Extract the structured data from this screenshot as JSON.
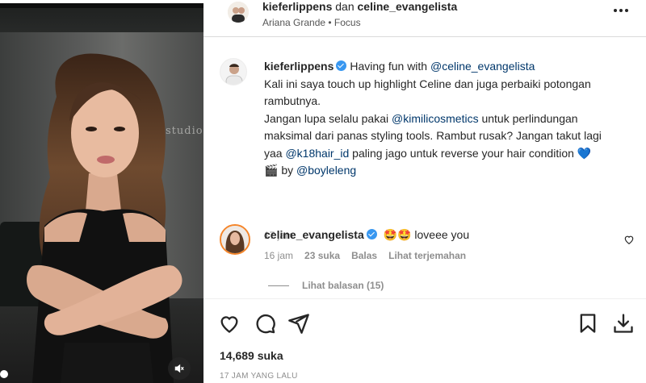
{
  "media": {
    "studio_sign": "studio",
    "progress": 1.0
  },
  "header": {
    "user1": "kieferlippens",
    "joiner": "dan",
    "user2": "celine_evangelista",
    "audio": "Ariana Grande • Focus"
  },
  "caption": {
    "username": "kieferlippens",
    "line1_intro": "Having fun with ",
    "mention1": "@celine_evangelista",
    "line2": "Kali ini saya touch up highlight Celine dan juga perbaiki potongan rambutnya.",
    "line3_a": "Jangan lupa selalu pakai ",
    "mention2": "@kimilicosmetics",
    "line3_b": " untuk perlindungan maksimal dari panas styling tools. Rambut rusak? Jangan takut lagi yaa ",
    "mention3": "@k18hair_id",
    "line3_c": " paling jago untuk reverse your hair condition",
    "heart": "💙",
    "credit_icon": "🎬",
    "credit_by": "by ",
    "mention4": "@boyleleng",
    "time": "17 jam"
  },
  "comment": {
    "username": "celine_evangelista",
    "emojis": "🤩🤩",
    "text": "loveee you",
    "time": "16 jam",
    "likes": "23 suka",
    "reply": "Balas",
    "translate": "Lihat terjemahan",
    "view_replies": "Lihat balasan (15)"
  },
  "actions": {
    "likes": "14,689 suka",
    "date": "17 JAM YANG LALU"
  },
  "icons": {
    "like": "heart-icon",
    "comment": "comment-icon",
    "share": "send-icon",
    "save": "bookmark-icon",
    "download": "download-icon",
    "mute": "speaker-muted-icon",
    "more": "more-icon"
  },
  "colors": {
    "mention": "#00376b",
    "verified": "#3897f0",
    "muted_text": "#8e8e8e"
  }
}
